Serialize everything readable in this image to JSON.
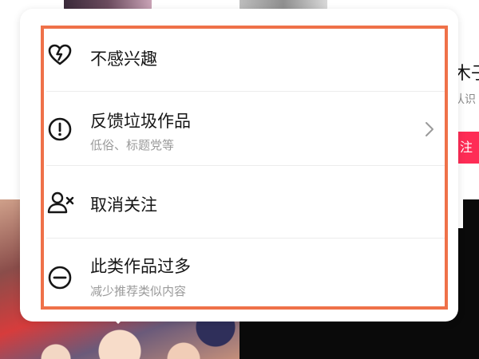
{
  "background": {
    "side_name": "木子",
    "side_sub": "认识",
    "side_follow": "注"
  },
  "menu": {
    "items": [
      {
        "id": "not-interested",
        "title": "不感兴趣",
        "subtitle": "",
        "icon": "broken-heart-icon"
      },
      {
        "id": "report-spam",
        "title": "反馈垃圾作品",
        "subtitle": "低俗、标题党等",
        "icon": "exclamation-circle-icon",
        "has_chevron": true
      },
      {
        "id": "unfollow",
        "title": "取消关注",
        "subtitle": "",
        "icon": "user-remove-icon"
      },
      {
        "id": "too-many",
        "title": "此类作品过多",
        "subtitle": "减少推荐类似内容",
        "icon": "minus-circle-icon"
      }
    ]
  },
  "colors": {
    "highlight_frame": "#ef7149",
    "follow_button": "#fe2c55",
    "title_text": "#161616",
    "subtitle_text": "#9a9a9a"
  }
}
